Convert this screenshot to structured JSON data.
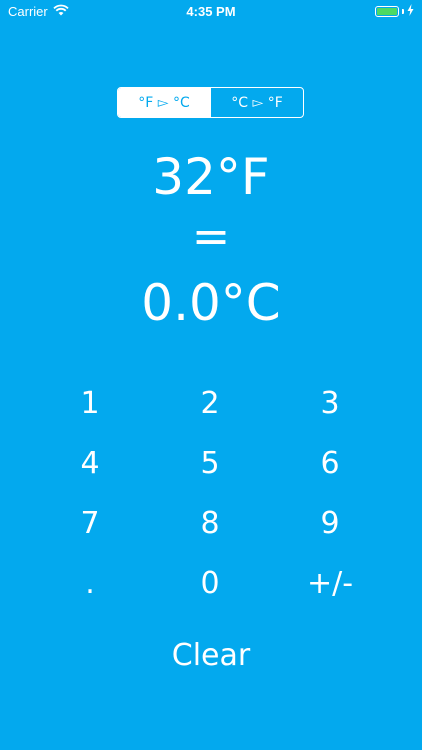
{
  "status_bar": {
    "carrier": "Carrier",
    "time": "4:35 PM",
    "battery_color": "#4CD964"
  },
  "mode_toggle": {
    "f_to_c_label": "°F ▻ °C",
    "c_to_f_label": "°C ▻ °F",
    "selected": "f_to_c"
  },
  "display": {
    "input": "32°F",
    "equals": "=",
    "result": "0.0°C"
  },
  "keypad": {
    "keys": [
      "1",
      "2",
      "3",
      "4",
      "5",
      "6",
      "7",
      "8",
      "9",
      ".",
      "0",
      "+/-"
    ],
    "clear_label": "Clear"
  },
  "colors": {
    "background": "#03A9EE",
    "foreground": "#FFFFFF"
  }
}
